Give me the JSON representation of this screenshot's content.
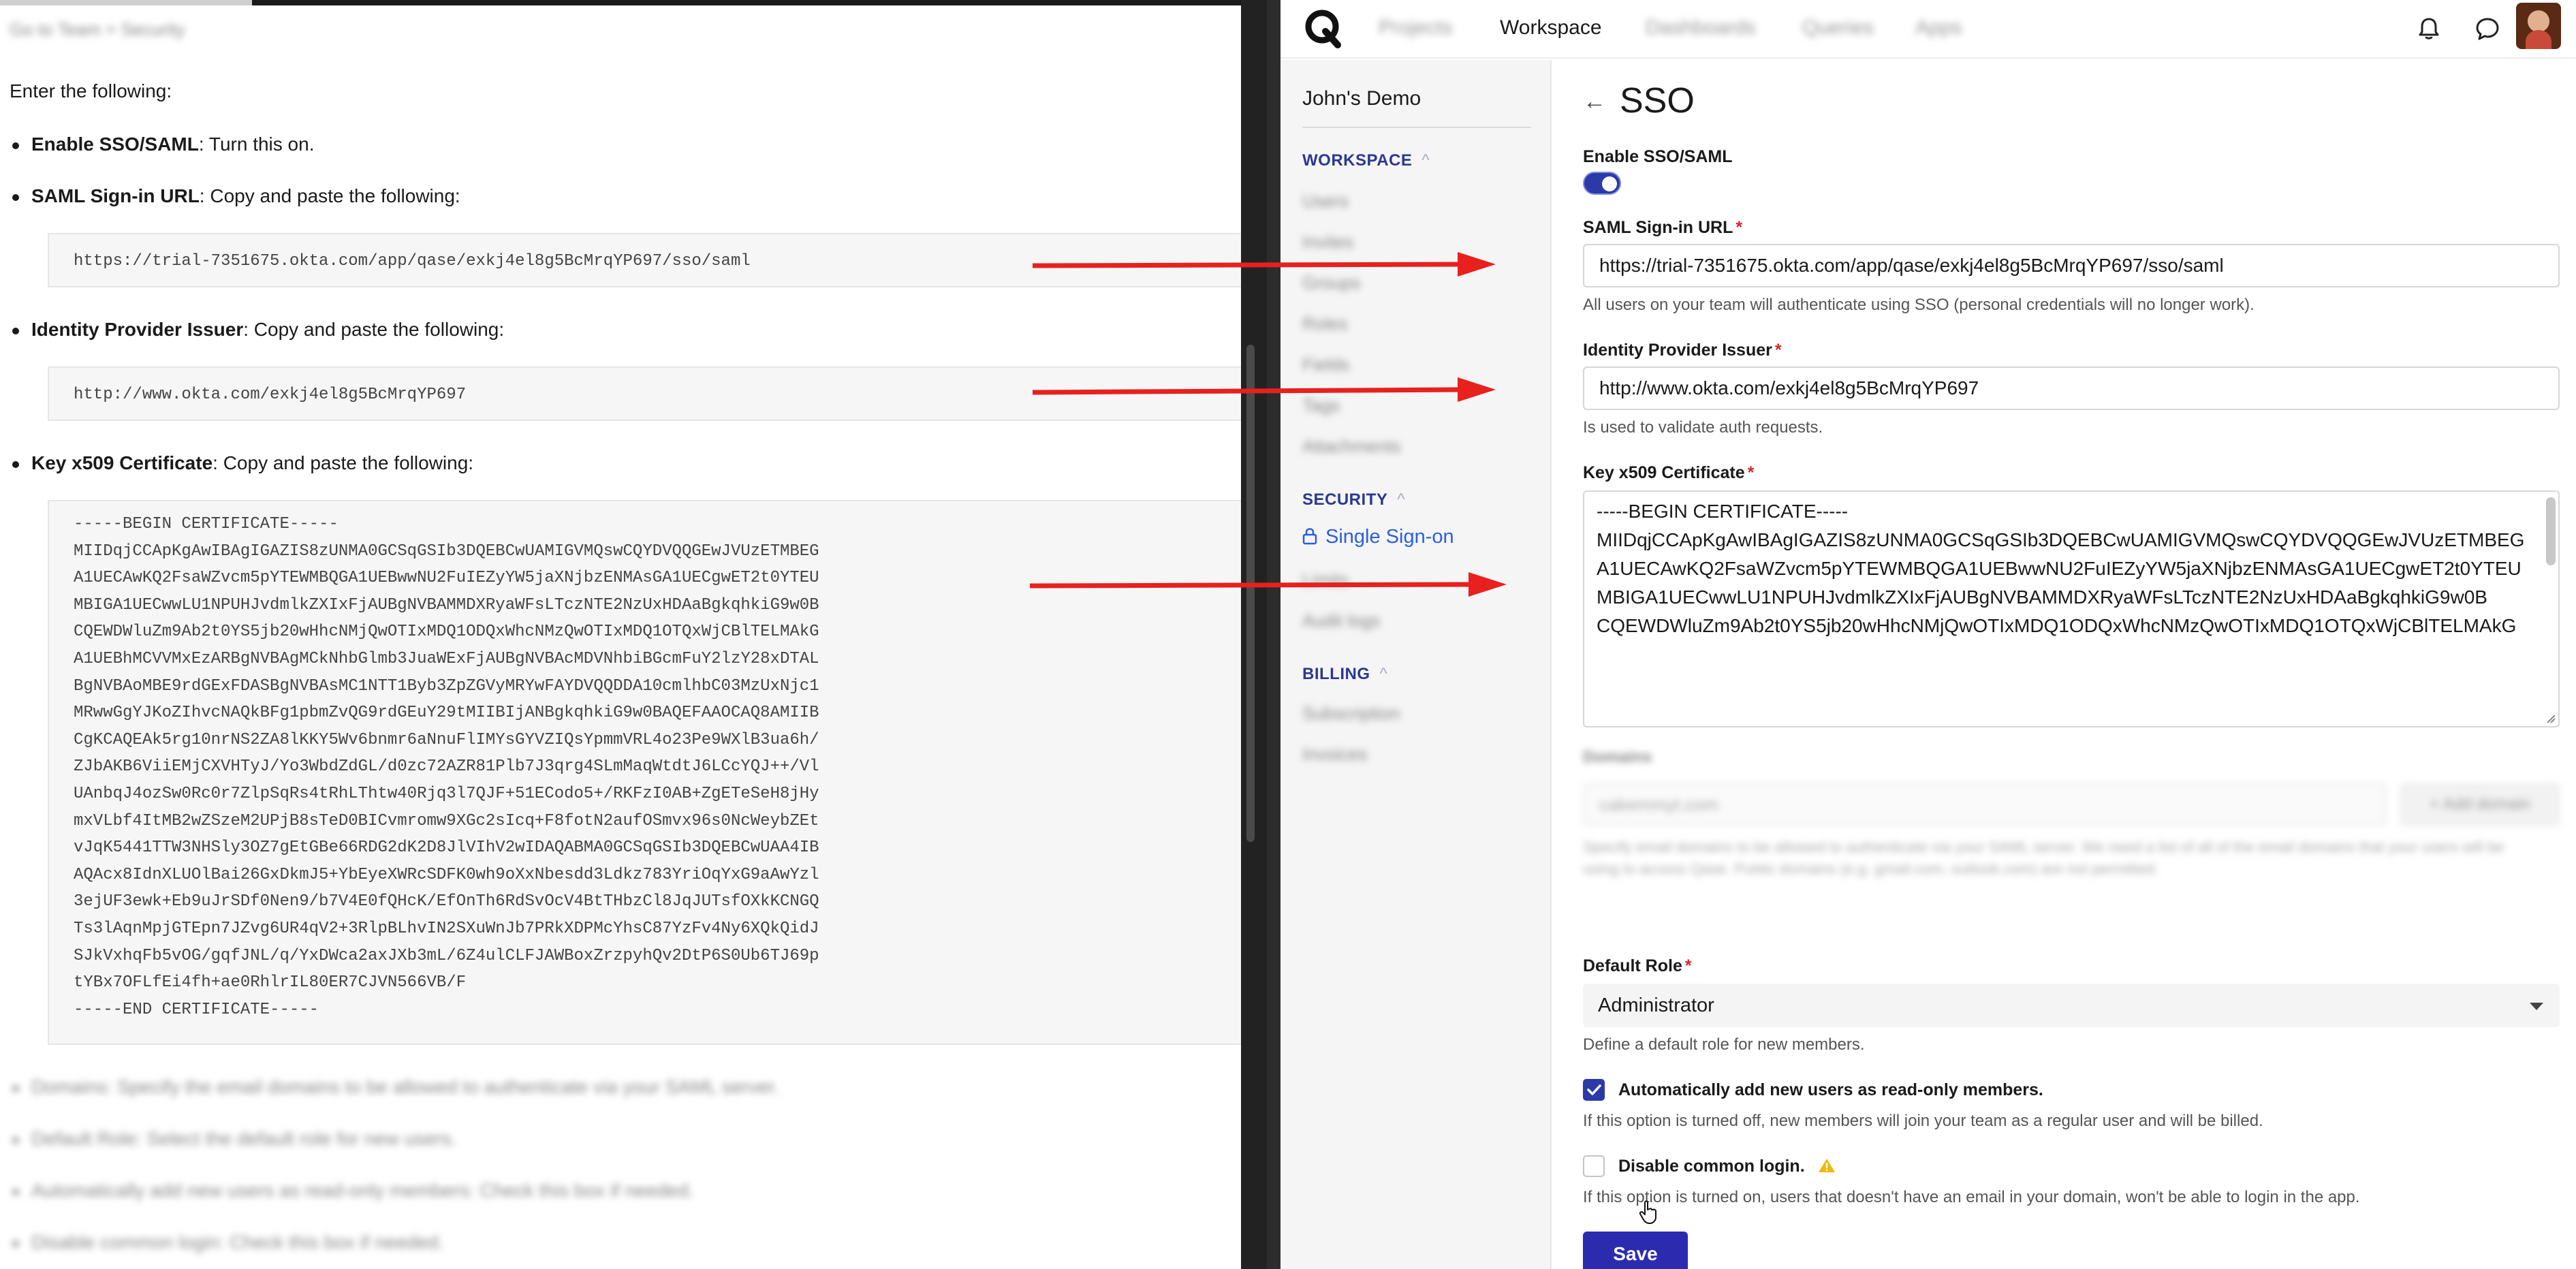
{
  "doc": {
    "breadcrumb": "Go to Team > Security",
    "intro": "Enter the following:",
    "bullets": [
      {
        "bold": "Enable SSO/SAML",
        "rest": ": Turn this on."
      },
      {
        "bold": "SAML Sign-in URL",
        "rest": ": Copy and paste the following:"
      },
      {
        "bold": "Identity Provider Issuer",
        "rest": ": Copy and paste the following:"
      },
      {
        "bold": "Key x509 Certificate",
        "rest": ": Copy and paste the following:"
      }
    ],
    "code_saml_url": "https://trial-7351675.okta.com/app/qase/exkj4el8g5BcMrqYP697/sso/saml",
    "code_issuer": "http://www.okta.com/exkj4el8g5BcMrqYP697",
    "cert_lines": [
      "-----BEGIN CERTIFICATE-----",
      "MIIDqjCCApKgAwIBAgIGAZIS8zUNMA0GCSqGSIb3DQEBCwUAMIGVMQswCQYDVQQGEwJVUzETMBEG",
      "A1UECAwKQ2FsaWZvcm5pYTEWMBQGA1UEBwwNU2FuIEZyYW5jaXNjbzENMAsGA1UECgwET2t0YTEU",
      "MBIGA1UECwwLU1NPUHJvdmlkZXIxFjAUBgNVBAMMDXRyaWFsLTczNTE2NzUxHDAaBgkqhkiG9w0B",
      "CQEWDWluZm9Ab2t0YS5jb20wHhcNMjQwOTIxMDQ1ODQxWhcNMzQwOTIxMDQ1OTQxWjCBlTELMAkG",
      "A1UEBhMCVVMxEzARBgNVBAgMCkNhbGlmb3JuaWExFjAUBgNVBAcMDVNhbiBGcmFuY2lzY28xDTAL",
      "BgNVBAoMBE9rdGExFDASBgNVBAsMC1NTT1Byb3ZpZGVyMRYwFAYDVQQDDA10cmlhbC03MzUxNjc1",
      "MRwwGgYJKoZIhvcNAQkBFg1pbmZvQG9rdGEuY29tMIIBIjANBgkqhkiG9w0BAQEFAAOCAQ8AMIIB",
      "CgKCAQEAk5rg10nrNS2ZA8lKKY5Wv6bnmr6aNnuFlIMYsGYVZIQsYpmmVRL4o23Pe9WXlB3ua6h/",
      "ZJbAKB6ViiEMjCXVHTyJ/Yo3WbdZdGL/d0zc72AZR81Plb7J3qrg4SLmMaqWtdtJ6LCcYQJ++/Vl",
      "UAnbqJ4ozSw0Rc0r7ZlpSqRs4tRhLThtw40Rjq3l7QJF+51ECodo5+/RKFzI0AB+ZgETeSeH8jHy",
      "mxVLbf4ItMB2wZSzeM2UPjB8sTeD0BICvmromw9XGc2sIcq+F8fotN2aufOSmvx96s0NcWeybZEt",
      "vJqK5441TTW3NHSly3OZ7gEtGBe66RDG2dK2D8JlVIhV2wIDAQABMA0GCSqGSIb3DQEBCwUAA4IB",
      "AQAcx8IdnXLUOlBai26GxDkmJ5+YbEyeXWRcSDFK0wh9oXxNbesdd3Ldkz783YriOqYxG9aAwYzl",
      "3ejUF3ewk+Eb9uJrSDf0Nen9/b7V4E0fQHcK/EfOnTh6RdSvOcV4BtTHbzCl8JqJUTsfOXkKCNGQ",
      "Ts3lAqnMpjGTEpn7JZvg6UR4qV2+3RlpBLhvIN2SXuWnJb7PRkXDPMcYhsC87YzFv4Ny6XQkQidJ",
      "SJkVxhqFb5vOG/gqfJNL/q/YxDWca2axJXb3mL/6Z4ulCLFJAWBoxZrzpyhQv2DtP6S0Ub6TJ69p",
      "tYBx7OFLfEi4fh+ae0RhlrIL80ER7CJVN566VB/F",
      "-----END CERTIFICATE-----"
    ],
    "blurred_bullets": [
      "Domains: Specify the email domains to be allowed to authenticate via your SAML server.",
      "Default Role: Select the default role for new users.",
      "Automatically add new users as read-only members: Check this box if needed.",
      "Disable common login: Check this box if needed."
    ]
  },
  "nav": {
    "items": [
      "Projects",
      "Workspace",
      "Dashboards",
      "Queries",
      "Apps"
    ],
    "active": "Workspace"
  },
  "sidebar": {
    "workspace_name": "John's Demo",
    "workspace_section": "WORKSPACE",
    "workspace_items": [
      "Users",
      "Invites",
      "Groups",
      "Roles",
      "Fields",
      "Tags",
      "Attachments"
    ],
    "security_section": "SECURITY",
    "security_items": [
      "Single Sign-on",
      "Limits",
      "Audit logs"
    ],
    "billing_section": "BILLING",
    "billing_items": [
      "Subscription",
      "Invoices"
    ]
  },
  "form": {
    "title": "SSO",
    "enable_label": "Enable SSO/SAML",
    "enable_on": true,
    "saml_label": "SAML Sign-in URL",
    "saml_value": "https://trial-7351675.okta.com/app/qase/exkj4el8g5BcMrqYP697/sso/saml",
    "saml_help": "All users on your team will authenticate using SSO (personal credentials will no longer work).",
    "issuer_label": "Identity Provider Issuer",
    "issuer_value": "http://www.okta.com/exkj4el8g5BcMrqYP697",
    "issuer_help": "Is used to validate auth requests.",
    "cert_label": "Key x509 Certificate",
    "cert_value": "-----BEGIN CERTIFICATE-----\nMIIDqjCCApKgAwIBAgIGAZIS8zUNMA0GCSqGSIb3DQEBCwUAMIGVMQswCQYDVQQGEwJVUzETMBEG\nA1UECAwKQ2FsaWZvcm5pYTEWMBQGA1UEBwwNU2FuIEZyYW5jaXNjbzENMAsGA1UECgwET2t0YTEU\nMBIGA1UECwwLU1NPUHJvdmlkZXIxFjAUBgNVBAMMDXRyaWFsLTczNTE2NzUxHDAaBgkqhkiG9w0B\nCQEWDWluZm9Ab2t0YS5jb20wHhcNMjQwOTIxMDQ1ODQxWhcNMzQwOTIxMDQ1OTQxWjCBlTELMAkG",
    "domains_label": "Domains",
    "domains_placeholder": "cakemmyt.com",
    "domains_button": "+ Add domain",
    "domains_help": "Specify email domains to be allowed to authenticate via your SAML server. We need a list of all of the email domains that your users will be using to access Qase. Public domains (e.g. gmail.com, outlook.com) are not permitted.",
    "role_label": "Default Role",
    "role_value": "Administrator",
    "role_help": "Define a default role for new members.",
    "auto_add_label": "Automatically add new users as read-only members.",
    "auto_add_checked": true,
    "auto_add_help": "If this option is turned off, new members will join your team as a regular user and will be billed.",
    "disable_login_label": "Disable common login.",
    "disable_login_checked": false,
    "disable_login_help": "If this option is turned on, users that doesn't have an email in your domain, won't be able to login in the app.",
    "save_label": "Save"
  },
  "colors": {
    "accent": "#2b3aa8",
    "arrow": "#e8201e",
    "required": "#d9262b"
  }
}
